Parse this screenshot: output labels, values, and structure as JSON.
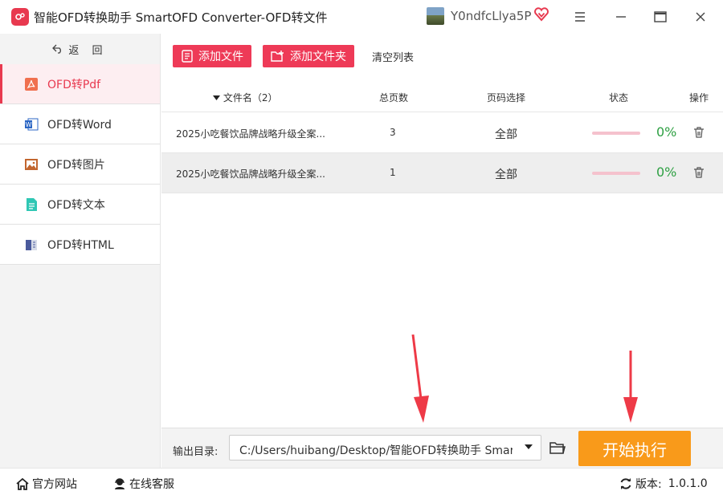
{
  "app": {
    "logo_text": "ofd",
    "title": "智能OFD转换助手 SmartOFD Converter-OFD转文件",
    "user_name": "Y0ndfcLlya5P"
  },
  "sidebar": {
    "back_label": "返 回",
    "items": [
      {
        "label": "OFD转Pdf",
        "icon": "pdf-icon",
        "active": true
      },
      {
        "label": "OFD转Word",
        "icon": "word-icon"
      },
      {
        "label": "OFD转图片",
        "icon": "image-icon"
      },
      {
        "label": "OFD转文本",
        "icon": "text-icon"
      },
      {
        "label": "OFD转HTML",
        "icon": "html-icon"
      }
    ]
  },
  "toolbar": {
    "add_file": "添加文件",
    "add_folder": "添加文件夹",
    "clear_list": "清空列表"
  },
  "table": {
    "headers": {
      "filename": "文件名（2）",
      "pages": "总页数",
      "range": "页码选择",
      "status": "状态",
      "action": "操作"
    },
    "rows": [
      {
        "filename": "2025小吃餐饮品牌战略升级全案...",
        "pages": "3",
        "range": "全部",
        "progress": 0,
        "pct": "0%"
      },
      {
        "filename": "2025小吃餐饮品牌战略升级全案...",
        "pages": "1",
        "range": "全部",
        "progress": 0,
        "pct": "0%"
      }
    ]
  },
  "output": {
    "label": "输出目录:",
    "path": "C:/Users/huibang/Desktop/智能OFD转换助手 SmartOFD",
    "start": "开始执行"
  },
  "status_bar": {
    "website": "官方网站",
    "support": "在线客服",
    "version_label": "版本:",
    "version": "1.0.1.0"
  },
  "colors": {
    "accent": "#e8394f",
    "start": "#f99a1a",
    "success": "#2ea043"
  }
}
